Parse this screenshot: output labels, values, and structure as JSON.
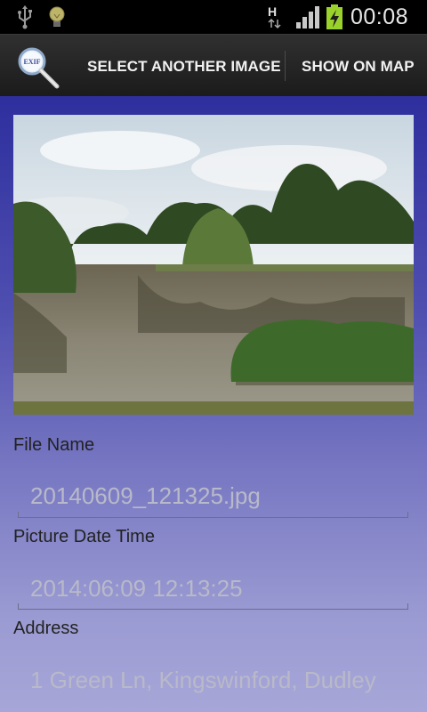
{
  "status_bar": {
    "time": "00:08",
    "network_type": "H",
    "icons": [
      "usb-icon",
      "bulb-icon",
      "network-h-icon",
      "signal-icon",
      "battery-charging-icon"
    ]
  },
  "action_bar": {
    "app_icon_text": "EXIF",
    "select_image_label": "SELECT ANOTHER IMAGE",
    "show_on_map_label": "SHOW ON MAP"
  },
  "content": {
    "image_description": "lake-with-trees-photo",
    "fields": [
      {
        "label": "File Name",
        "value": "20140609_121325.jpg"
      },
      {
        "label": "Picture Date Time",
        "value": "2014:06:09 12:13:25"
      },
      {
        "label": "Address",
        "value": "1 Green Ln, Kingswinford, Dudley"
      }
    ]
  },
  "colors": {
    "action_bar": "#222222",
    "content_top": "#2e2e9e",
    "content_bottom": "#a6a6d8"
  }
}
